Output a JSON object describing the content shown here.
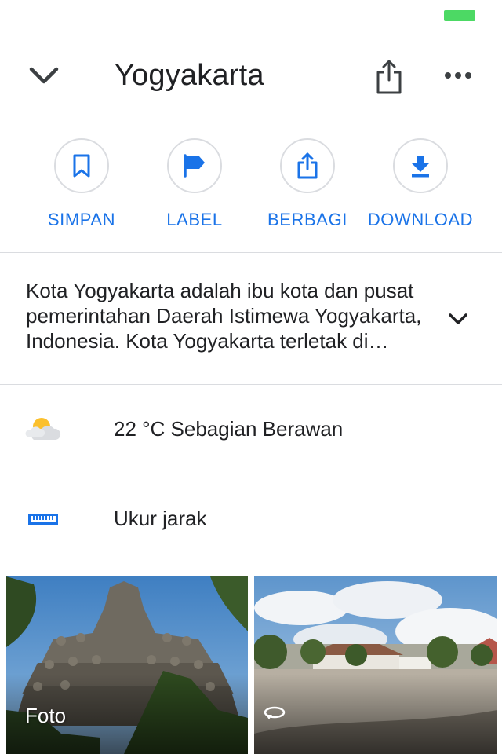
{
  "status_bar": {
    "battery_color": "#4cd964"
  },
  "header": {
    "title": "Yogyakarta",
    "icons": [
      "chevron-down-icon",
      "share-icon",
      "more-horizontal-icon"
    ]
  },
  "actions": [
    {
      "label": "SIMPAN",
      "icon": "bookmark-icon"
    },
    {
      "label": "LABEL",
      "icon": "flag-icon"
    },
    {
      "label": "BERBAGI",
      "icon": "share-icon"
    },
    {
      "label": "DOWNLOAD",
      "icon": "download-icon"
    }
  ],
  "description": {
    "text": "Kota Yogyakarta adalah ibu kota dan pusat pemerintahan Daerah Istimewa Yogyakarta, Indonesia. Kota Yogyakarta terletak di bagian tengah-selatan Pulau Jawa.",
    "icon": "chevron-down-icon"
  },
  "weather": {
    "text": "22 °C Sebagian Berawan",
    "icon": "partly-cloudy-icon"
  },
  "measure": {
    "text": "Ukur jarak",
    "icon": "ruler-icon"
  },
  "photos": [
    {
      "caption": "Foto",
      "subject": "borobudur-temple"
    },
    {
      "caption": "",
      "subject": "street-view-courtyard",
      "icon": "rotate-360-icon"
    }
  ],
  "colors": {
    "accent": "#1a73e8",
    "divider": "#dadce0",
    "text": "#202124",
    "icon_dark": "#3c4043"
  }
}
